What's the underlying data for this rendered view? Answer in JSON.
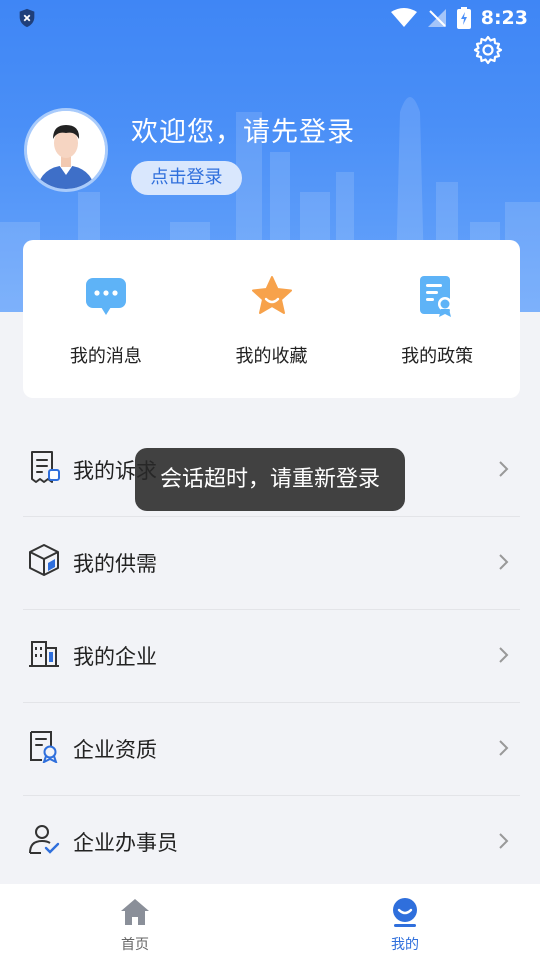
{
  "status_bar": {
    "time": "8:23"
  },
  "profile": {
    "welcome_text": "欢迎您，请先登录",
    "login_button": "点击登录"
  },
  "quick_actions": [
    {
      "label": "我的消息",
      "icon": "message-bubble-icon"
    },
    {
      "label": "我的收藏",
      "icon": "star-icon"
    },
    {
      "label": "我的政策",
      "icon": "policy-document-icon"
    }
  ],
  "menu": [
    {
      "label": "我的诉求",
      "icon": "receipt-icon"
    },
    {
      "label": "我的供需",
      "icon": "cube-icon"
    },
    {
      "label": "我的企业",
      "icon": "building-icon"
    },
    {
      "label": "企业资质",
      "icon": "certificate-icon"
    },
    {
      "label": "企业办事员",
      "icon": "user-check-icon"
    }
  ],
  "toast": {
    "message": "会话超时，请重新登录"
  },
  "tab_bar": {
    "tabs": [
      {
        "label": "首页",
        "icon": "home-icon",
        "active": false
      },
      {
        "label": "我的",
        "icon": "profile-face-icon",
        "active": true
      }
    ]
  },
  "colors": {
    "primary": "#2f6fdc",
    "header_blue": "#3f86f5",
    "background": "#f2f3f7"
  }
}
